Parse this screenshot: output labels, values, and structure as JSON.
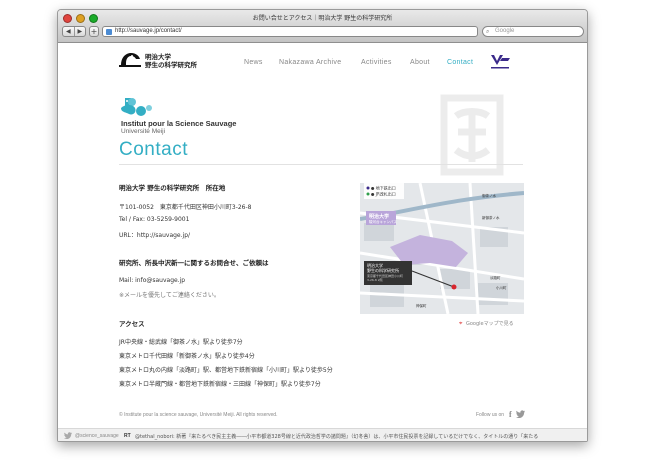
{
  "window": {
    "title": "お問い合せとアクセス｜明治大学 野生の科学研究所",
    "url": "http://sauvage.jp/contact/",
    "search_placeholder": "Google"
  },
  "header": {
    "logo_text_line1": "明治大学",
    "logo_text_line2": "野生の科学研究所",
    "nav": [
      {
        "label": "News"
      },
      {
        "label": "Nakazawa Archive"
      },
      {
        "label": "Activities"
      },
      {
        "label": "About"
      },
      {
        "label": "Contact"
      }
    ]
  },
  "institute": {
    "name": "Institut pour la Science Sauvage",
    "sub": "Université Meiji"
  },
  "page_title": "Contact",
  "address": {
    "title": "明治大学 野生の科学研究所　所在地",
    "postal": "〒101-0052　東京都千代田区神田小川町3-26-8",
    "tel": "Tel / Fax: 03-5259-9001",
    "url": "URL：http://sauvage.jp/"
  },
  "inquiry": {
    "title": "研究所、所長中沢新一に関するお問合せ、ご依頼は",
    "mail": "Mail: info@sauvage.jp",
    "note": "※メールを優先してご連絡ください。"
  },
  "access": {
    "title": "アクセス",
    "lines": [
      "JR中央線・総武線「御茶ノ水」駅より徒歩7分",
      "東京メトロ千代田線「新御茶ノ水」駅より徒歩4分",
      "東京メトロ丸の内線「淡路町」駅、都営地下鉄新宿線「小川町」駅より徒歩5分",
      "東京メトロ半蔵門線・都営地下鉄新宿線・三田線「神保町」駅より徒歩7分"
    ]
  },
  "map": {
    "legend_subway": "● 地下鉄出口",
    "legend_jr": "● JR改札出口",
    "campus_label": "明治大学",
    "campus_sub": "駿河台キャンパス",
    "callout_line1": "明治大学",
    "callout_line2": "野生の科学研究所",
    "callout_line3": "東京都千代田区神田小川町",
    "callout_line4": "3-26-8 2階",
    "station_ochanomizu": "御茶ノ水",
    "station_shinochanomizu": "新御茶ノ水",
    "station_awajicho": "淡路町",
    "station_ogawamachi": "小川町",
    "station_jimbocho": "神保町",
    "link_text": "Googleマップで見る"
  },
  "footer": {
    "copyright": "© Institute pour la science sauvage, Université Meiji. All rights reserved.",
    "follow": "Follow us on"
  },
  "twitter": {
    "handle": "@science_sauvage",
    "rt": "RT",
    "text": "@tethal_nobori: 新著『来たるべき民主主義――小平市都道328号線と近代政治哲学の諸問題』（幻冬舎）は、小平市住民投票を記録しているだけでなく、タイトルの通り「来たる"
  },
  "colors": {
    "accent": "#33aec4"
  }
}
